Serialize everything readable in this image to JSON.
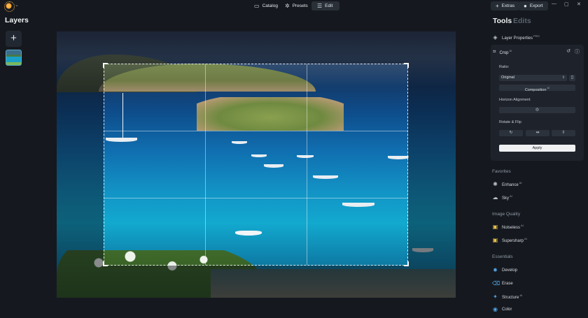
{
  "topbar": {
    "tabs": [
      {
        "label": "Catalog",
        "icon": "folder-icon"
      },
      {
        "label": "Presets",
        "icon": "presets-icon"
      },
      {
        "label": "Edit",
        "icon": "sliders-icon",
        "active": true
      }
    ],
    "extras_label": "Extras",
    "export_label": "Export"
  },
  "layers": {
    "title": "Layers",
    "add_label": "+"
  },
  "tools": {
    "title": "Tools",
    "edits_title": "Edits",
    "layer_properties": {
      "label": "Layer Properties",
      "badge": "PRO"
    },
    "crop": {
      "label": "Crop",
      "badge": "AI",
      "ratio_label": "Ratio:",
      "ratio_value": "Original",
      "composition_label": "Composition",
      "composition_badge": "AI",
      "horizon_label": "Horizon Alignment",
      "rotate_flip_label": "Rotate & Flip",
      "apply_label": "Apply"
    },
    "sections": {
      "favorites": "Favorites",
      "image_quality": "Image Quality",
      "essentials": "Essentials"
    },
    "favorites": [
      {
        "label": "Enhance",
        "badge": "AI",
        "icon": "enhance-icon"
      },
      {
        "label": "Sky",
        "badge": "AI",
        "icon": "cloud-icon"
      }
    ],
    "image_quality": [
      {
        "label": "Noiseless",
        "badge": "AI",
        "icon": "noiseless-icon"
      },
      {
        "label": "Supersharp",
        "badge": "AI",
        "icon": "supersharp-icon"
      }
    ],
    "essentials": [
      {
        "label": "Develop",
        "badge": "",
        "icon": "develop-icon"
      },
      {
        "label": "Erase",
        "badge": "",
        "icon": "erase-icon"
      },
      {
        "label": "Structure",
        "badge": "AI",
        "icon": "structure-icon"
      },
      {
        "label": "Color",
        "badge": "",
        "icon": "color-icon"
      }
    ]
  },
  "colors": {
    "accent": "#3b82c4",
    "background": "#15191f",
    "panel": "#1e232b"
  }
}
